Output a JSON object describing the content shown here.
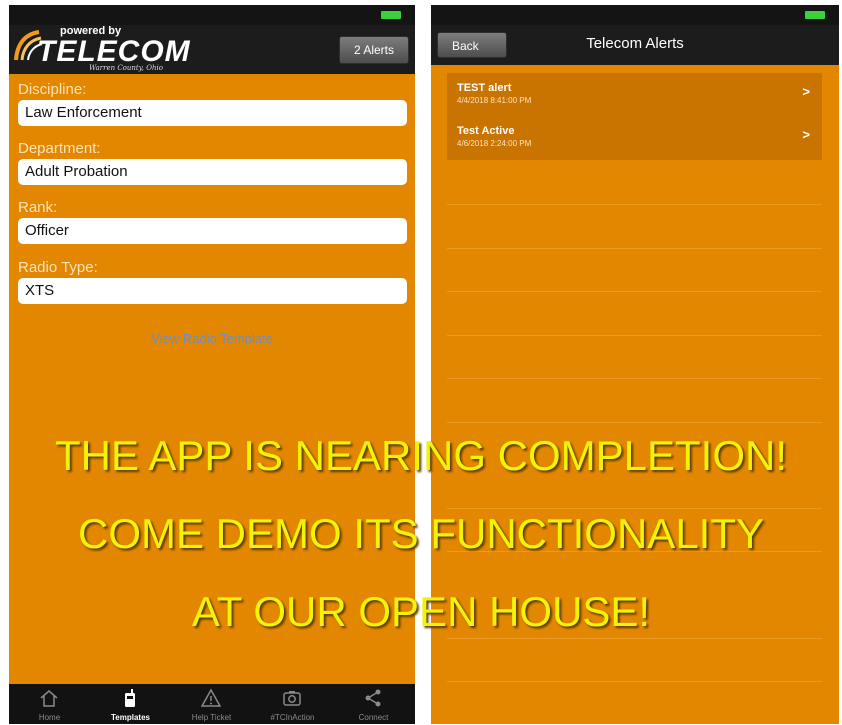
{
  "left_screen": {
    "logo": {
      "powered_by": "powered by",
      "wordmark": "TELECOM",
      "subtitle": "Warren County, Ohio"
    },
    "alerts_button": "2 Alerts",
    "fields": [
      {
        "label": "Discipline:",
        "value": "Law Enforcement"
      },
      {
        "label": "Department:",
        "value": "Adult Probation"
      },
      {
        "label": "Rank:",
        "value": "Officer"
      },
      {
        "label": "Radio Type:",
        "value": "XTS"
      }
    ],
    "view_template_link": "View Radio Template",
    "tabs": [
      {
        "label": "Home",
        "icon": "home-icon",
        "active": false
      },
      {
        "label": "Templates",
        "icon": "radio-icon",
        "active": true
      },
      {
        "label": "Help Ticket",
        "icon": "warning-icon",
        "active": false
      },
      {
        "label": "#TCInAction",
        "icon": "camera-icon",
        "active": false
      },
      {
        "label": "Connect",
        "icon": "share-icon",
        "active": false
      }
    ]
  },
  "right_screen": {
    "back_button": "Back",
    "title": "Telecom Alerts",
    "alerts": [
      {
        "title": "TEST alert",
        "date": "4/4/2018 8:41:00 PM",
        "chevron": ">"
      },
      {
        "title": "Test Active",
        "date": "4/6/2018 2:24:00 PM",
        "chevron": ">"
      }
    ]
  },
  "overlay": {
    "line1": "THE APP IS NEARING COMPLETION!",
    "line2": "COME DEMO ITS FUNCTIONALITY",
    "line3": "AT OUR OPEN HOUSE!"
  },
  "colors": {
    "app_orange": "#e48700",
    "overlay_text": "#f3f30a",
    "header_dark": "#1c1c1c"
  }
}
